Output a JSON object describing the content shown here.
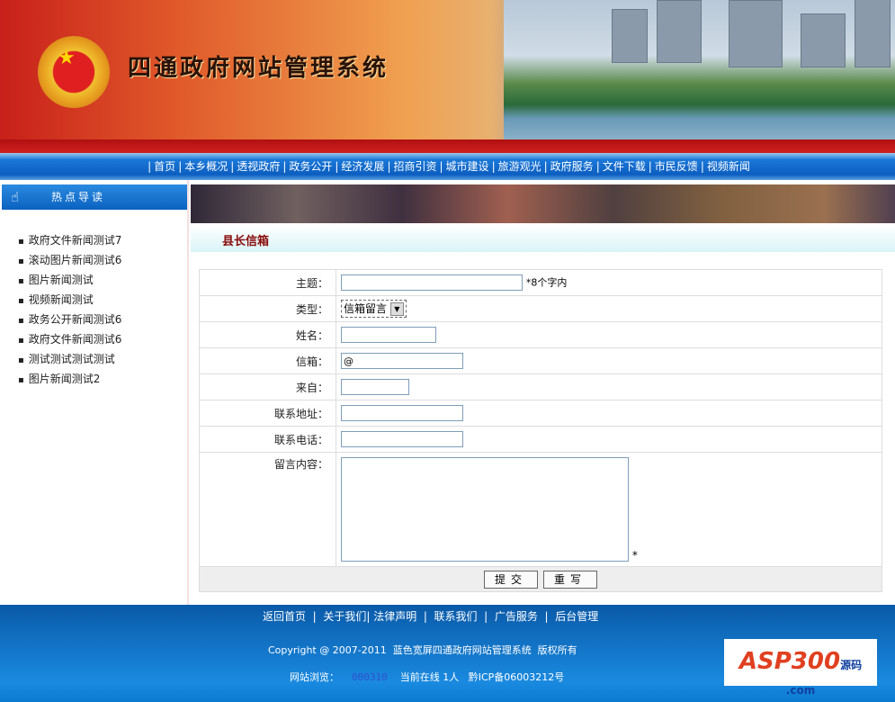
{
  "header": {
    "title": "四通政府网站管理系统"
  },
  "nav": [
    "首页",
    "本乡概况",
    "透视政府",
    "政务公开",
    "经济发展",
    "招商引资",
    "城市建设",
    "旅游观光",
    "政府服务",
    "文件下载",
    "市民反馈",
    "视频新闻"
  ],
  "sidebar": {
    "title": "热点导读",
    "items": [
      "政府文件新闻测试7",
      "滚动图片新闻测试6",
      "图片新闻测试",
      "视频新闻测试",
      "政务公开新闻测试6",
      "政府文件新闻测试6",
      "测试测试测试测试",
      "图片新闻测试2"
    ]
  },
  "main": {
    "title": "县长信箱",
    "form": {
      "subject_label": "主题：",
      "subject_hint": "*8个字内",
      "type_label": "类型：",
      "type_value": "信箱留言",
      "name_label": "姓名：",
      "email_label": "信箱：",
      "email_value": "@",
      "from_label": "来自：",
      "address_label": "联系地址：",
      "phone_label": "联系电话：",
      "content_label": "留言内容：",
      "required_mark": "*",
      "submit": "提交",
      "reset": "重写"
    }
  },
  "footer": {
    "links": [
      "返回首页",
      "关于我们",
      "法律声明",
      "联系我们",
      "广告服务",
      "后台管理"
    ],
    "copyright": "Copyright @ 2007-2011  蓝色宽屏四通政府网站管理系统  版权所有",
    "visits_label": "网站浏览：",
    "visits": "000310",
    "online": "当前在线 1人",
    "icp": "黔ICP备06003212号",
    "logo_text": "ASP300",
    "logo_sub": "源码 .com"
  }
}
